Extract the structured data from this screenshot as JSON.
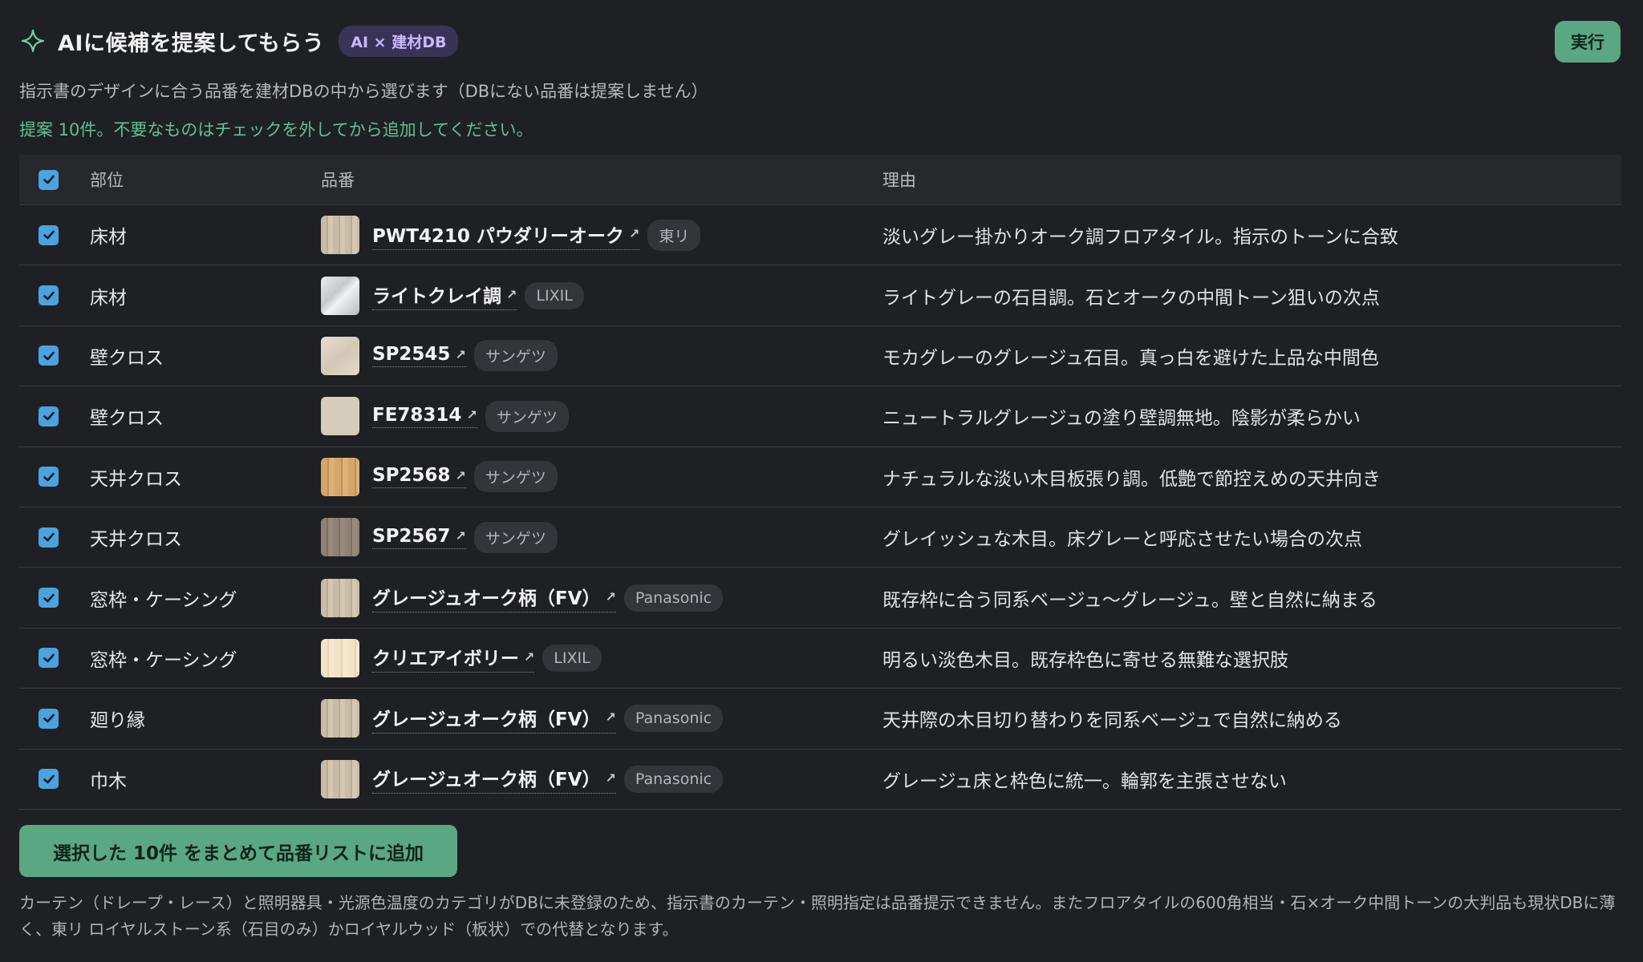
{
  "header": {
    "title": "AIに候補を提案してもらう",
    "tag": "AI × 建材DB",
    "run_button": "実行"
  },
  "description": "指示書のデザインに合う品番を建材DBの中から選びます（DBにない品番は提案しません）",
  "notice": "提案 10件。不要なものはチェックを外してから追加してください。",
  "table": {
    "headers": {
      "part": "部位",
      "product": "品番",
      "reason": "理由"
    },
    "rows": [
      {
        "part": "床材",
        "product": "PWT4210 パウダリーオーク",
        "maker": "東リ",
        "swatch": "oak",
        "reason": "淡いグレー掛かりオーク調フロアタイル。指示のトーンに合致",
        "checked": true
      },
      {
        "part": "床材",
        "product": "ライトクレイ調",
        "maker": "LIXIL",
        "swatch": "stone",
        "reason": "ライトグレーの石目調。石とオークの中間トーン狙いの次点",
        "checked": true
      },
      {
        "part": "壁クロス",
        "product": "SP2545",
        "maker": "サンゲツ",
        "swatch": "greige",
        "reason": "モカグレーのグレージュ石目。真っ白を避けた上品な中間色",
        "checked": true
      },
      {
        "part": "壁クロス",
        "product": "FE78314",
        "maker": "サンゲツ",
        "swatch": "plain",
        "reason": "ニュートラルグレージュの塗り壁調無地。陰影が柔らかい",
        "checked": true
      },
      {
        "part": "天井クロス",
        "product": "SP2568",
        "maker": "サンゲツ",
        "swatch": "wood",
        "reason": "ナチュラルな淡い木目板張り調。低艶で節控えめの天井向き",
        "checked": true
      },
      {
        "part": "天井クロス",
        "product": "SP2567",
        "maker": "サンゲツ",
        "swatch": "darkwood",
        "reason": "グレイッシュな木目。床グレーと呼応させたい場合の次点",
        "checked": true
      },
      {
        "part": "窓枠・ケーシング",
        "product": "グレージュオーク柄（FV）",
        "maker": "Panasonic",
        "swatch": "oak",
        "reason": "既存枠に合う同系ベージュ〜グレージュ。壁と自然に納まる",
        "checked": true
      },
      {
        "part": "窓枠・ケーシング",
        "product": "クリエアイボリー",
        "maker": "LIXIL",
        "swatch": "ivory",
        "reason": "明るい淡色木目。既存枠色に寄せる無難な選択肢",
        "checked": true
      },
      {
        "part": "廻り縁",
        "product": "グレージュオーク柄（FV）",
        "maker": "Panasonic",
        "swatch": "oak",
        "reason": "天井際の木目切り替わりを同系ベージュで自然に納める",
        "checked": true
      },
      {
        "part": "巾木",
        "product": "グレージュオーク柄（FV）",
        "maker": "Panasonic",
        "swatch": "oak",
        "reason": "グレージュ床と枠色に統一。輪郭を主張させない",
        "checked": true
      }
    ]
  },
  "add_button": "選択した 10件 をまとめて品番リストに追加",
  "footnote": "カーテン（ドレープ・レース）と照明器具・光源色温度のカテゴリがDBに未登録のため、指示書のカーテン・照明指定は品番提示できません。またフロアタイルの600角相当・石×オーク中間トーンの大判品も現状DBに薄く、東リ ロイヤルストーン系（石目のみ）かロイヤルウッド（板状）での代替となります。",
  "colors": {
    "background": "#1f2023",
    "accent_green": "#5aa784",
    "notice_green": "#5cc293",
    "checkbox_blue": "#4aa3df",
    "tag_purple": "#3a3358"
  },
  "icons": {
    "sparkle": "sparkle-icon",
    "external": "external-link-icon",
    "check": "check-icon"
  }
}
